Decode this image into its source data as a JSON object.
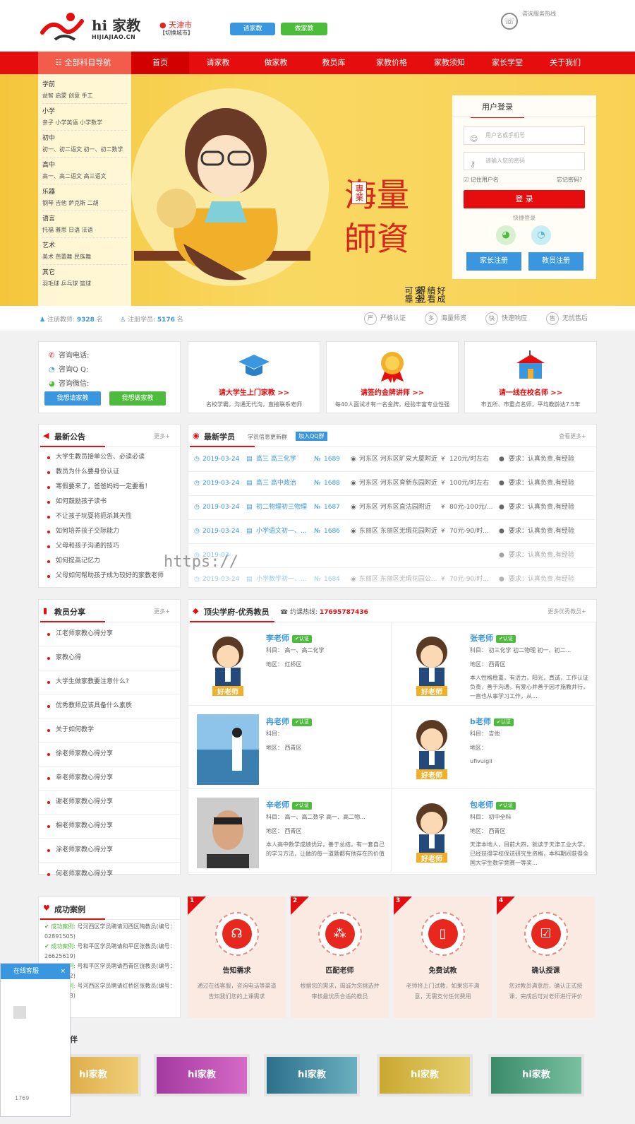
{
  "header": {
    "logo_text": "hi 家教",
    "logo_sub": "HIJIAJIAO.CN",
    "city": "天津市",
    "city_switch": "【切换城市】",
    "btn_find": "请家教",
    "btn_be": "做家教",
    "phone_label": "咨询服务热线"
  },
  "nav": {
    "all_label": "全部科目导航",
    "items": [
      "首页",
      "请家教",
      "做家教",
      "教员库",
      "家教价格",
      "家教须知",
      "家长学堂",
      "关于我们"
    ]
  },
  "categories": [
    {
      "title": "学前",
      "items": "益智  启蒙  创意  手工"
    },
    {
      "title": "小学",
      "items": "亲子  小学英语  小学数学"
    },
    {
      "title": "初中",
      "items": "初一、初二语文  初一、初二数学"
    },
    {
      "title": "高中",
      "items": "高一、高二语文  高三语文"
    },
    {
      "title": "乐器",
      "items": "钢琴  吉他  萨克斯  二胡"
    },
    {
      "title": "语言",
      "items": "托福  雅思  日语  法语"
    },
    {
      "title": "艺术",
      "items": "美术  芭蕾舞  民族舞"
    },
    {
      "title": "其它",
      "items": "羽毛球  乒乓球  篮球"
    }
  ],
  "banner": {
    "title": "海量師資",
    "tag": "專業",
    "slogan1": "好成績看得見",
    "slogan2": "安全可靠"
  },
  "login": {
    "title": "用户登录",
    "user_placeholder": "用户名或手机号",
    "pass_placeholder": "请输入您的密码",
    "remember": "记住用户名",
    "forgot": "忘记密码?",
    "btn": "登 录",
    "quick": "快捷登录",
    "reg_parent": "家长注册",
    "reg_teacher": "教员注册"
  },
  "stats": {
    "teachers_label": "注册教师:",
    "teachers": "9328",
    "students_label": "注册学员:",
    "students": "5176",
    "unit": "名",
    "badges": [
      {
        "c": "严",
        "t": "严格认证"
      },
      {
        "c": "多",
        "t": "海量师资"
      },
      {
        "c": "快",
        "t": "快速响应"
      },
      {
        "c": "售",
        "t": "无忧售后"
      }
    ]
  },
  "contact": {
    "phone": "咨询电话:",
    "qq": "咨询Q Q:",
    "wechat": "咨询微信:",
    "btn_find": "我想请家教",
    "btn_be": "我想做家教"
  },
  "features": [
    {
      "title": "请大学生上门家教 >>",
      "desc": "名校学霸，沟通无代沟，直接联系老师"
    },
    {
      "title": "请签约金牌讲师 >>",
      "desc": "每40人面试才有一名金牌，经验丰富专业性强"
    },
    {
      "title": "请一线在校名师 >>",
      "desc": "市五所、市重点名师，平均教龄达7.5年"
    }
  ],
  "notice": {
    "title": "最新公告",
    "more": "更多+",
    "items": [
      "大学生教员接单公告、必读必读",
      "教员为什么要身份认证",
      "寒假要来了，爸爸妈妈一定要看！",
      "如何鼓励孩子读书",
      "不让孩子玩耍将扼杀其天性",
      "如何培养孩子交际能力",
      "父母和孩子沟通的技巧",
      "如何提高记忆力",
      "父母如何帮助孩子成为较好的家教老师"
    ]
  },
  "students": {
    "title": "最新学员",
    "sub": "学员信息更新群",
    "join": "加入QQ群",
    "more": "查看更多+",
    "rows": [
      {
        "date": "2019-03-24",
        "subject": "高三 高三化学",
        "no": "1689",
        "addr": "河东区 河东区旷泉大厦附近",
        "price": "120元/时左右",
        "req": "要求：认真负责,有经验"
      },
      {
        "date": "2019-03-24",
        "subject": "高三 高中政治",
        "no": "1688",
        "addr": "河东区 河东区育新东园附近",
        "price": "100元/时左右",
        "req": "要求：认真负责,有经验"
      },
      {
        "date": "2019-03-24",
        "subject": "初二物理初三物理",
        "no": "1687",
        "addr": "河东区 河东区直沽园附近",
        "price": "80元-100元/...",
        "req": "要求：认真负责,有经验"
      },
      {
        "date": "2019-03-24",
        "subject": "小学语文初一、...",
        "no": "1686",
        "addr": "东丽区 东丽区无瑕花园附近",
        "price": "70元-90/时...",
        "req": "要求：认真负责,有经验"
      },
      {
        "date": "2019-03-",
        "subject": "",
        "no": "",
        "addr": "",
        "price": "",
        "req": "要求：认真负责,有经验"
      },
      {
        "date": "2019-03-24",
        "subject": "小学数学初一、...",
        "no": "1684",
        "addr": "东丽区 东丽区无瑕花园公...",
        "price": "70元-90/时...",
        "req": "要求：认真负责,有经验"
      }
    ]
  },
  "share": {
    "title": "教员分享",
    "more": "更多+",
    "items": [
      "江老师家教心得分享",
      "家教心得",
      "大学生做家教要注意什么?",
      "优秀教师应该具备什么素质",
      "关于如何教学",
      "徐老师家教心得分享",
      "幸老师家教心得分享",
      "谢老师家教心得分享",
      "相老师家教心得分享",
      "涂老师家教心得分享",
      "何老师家教心得分享"
    ]
  },
  "teachers": {
    "title": "顶尖学府-优秀教员",
    "hotline_label": "约课热线:",
    "hotline": "17695787436",
    "more": "更多优秀教员+",
    "badge": "认证",
    "list": [
      {
        "name": "李老师",
        "subject": "科目：  高一、高二化学",
        "area": "地区：  红桥区",
        "desc": "",
        "img": "cartoon"
      },
      {
        "name": "张老师",
        "subject": "科目：  初三化学 初二物理 初一、初二...",
        "area": "地区：  西青区",
        "desc": "本人性格稳重，有活力，阳光，真诚，工作认证负责，善于沟通，有爱心并善于因才施教并行，一直也从事学习工作，从...",
        "img": "cartoon"
      },
      {
        "name": "冉老师",
        "subject": "科目：",
        "area": "地区：  西青区",
        "desc": "",
        "img": "photo-sea"
      },
      {
        "name": "b老师",
        "subject": "科目：  吉他",
        "area": "地区：",
        "desc": "ufivuigli",
        "img": "cartoon"
      },
      {
        "name": "辛老师",
        "subject": "科目：  高一、高二数学 高一、高二物...",
        "area": "地区：  西青区",
        "desc": "本人高中数学成绩优异，善于总结，有一套自己的学习方法，让做的每一道题都有他存在的价值",
        "img": "photo-man"
      },
      {
        "name": "包老师",
        "subject": "科目：  初中全科",
        "area": "地区：  西青区",
        "desc": "天津本地人，目前大四，就读于天津工业大学，已经获得学校保送研究生资格，本科期间获得全国大学生数学竞赛一等奖...",
        "img": "cartoon"
      }
    ]
  },
  "cases": {
    "title": "成功案例",
    "label": "成功案例:",
    "items": [
      "号河西区学员聘请河西区陶教员(编号：02891505)",
      "号和平区学员聘请和平区张教员(编号：26625619)",
      "号和平区学员聘请西青区饶教员(编号：88815982)",
      "号河西区学员聘请红桥区张教员(编号：88686528)"
    ]
  },
  "steps": [
    {
      "n": "1",
      "title": "告知需求",
      "desc": "通过在线客服，咨询电话等渠道告知我们您的上课需求"
    },
    {
      "n": "2",
      "title": "匹配老师",
      "desc": "根据您的需求，竭诚为您挑选并审核最优质合适的教员"
    },
    {
      "n": "3",
      "title": "免费试教",
      "desc": "老师将上门试教，如果您不满意，无需支付任何费用"
    },
    {
      "n": "4",
      "title": "确认授课",
      "desc": "您对教员满意后，确认正式授课，完成后可对老师进行评价"
    }
  ],
  "partners": {
    "title": "伙伴",
    "items": [
      "hi家教",
      "hi家教",
      "hi家教",
      "hi家教",
      "hi家教"
    ]
  },
  "float": {
    "title": "在线客服",
    "phone": "1769"
  },
  "watermark": "https://",
  "colors": {
    "brand_red": "#e50d0d",
    "blue": "#3a97df",
    "green": "#4dbb3b"
  }
}
